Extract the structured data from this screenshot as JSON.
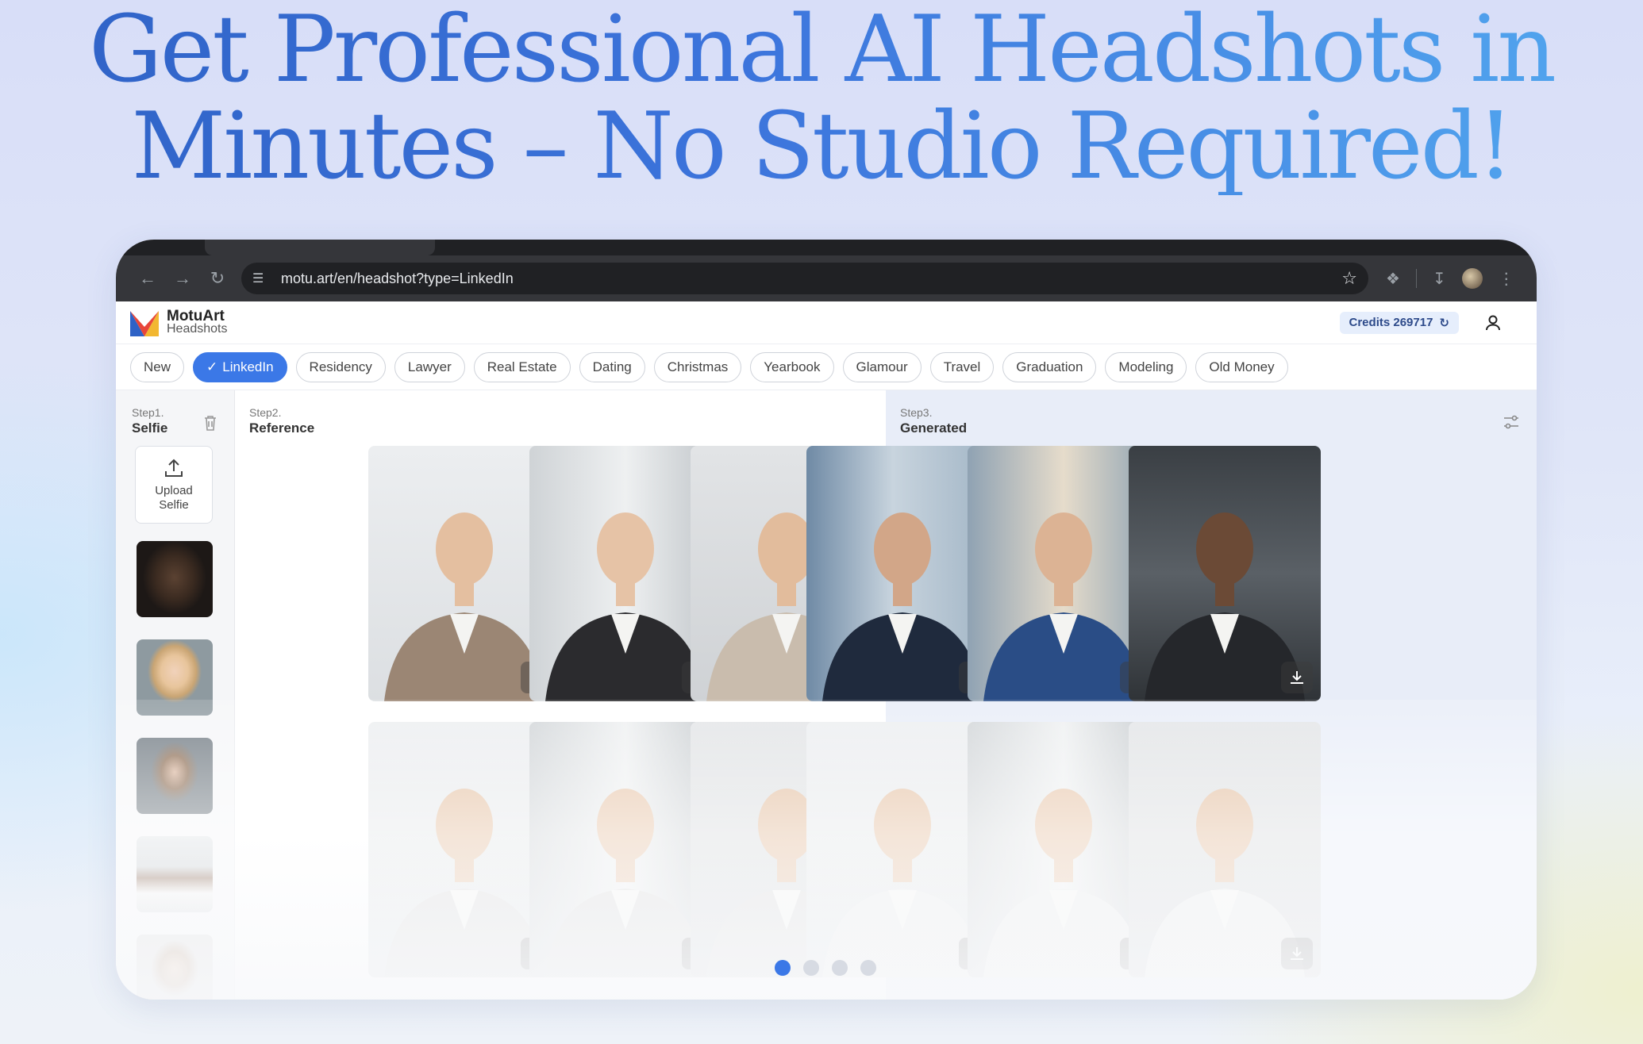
{
  "headline": {
    "line1": "Get Professional AI Headshots in",
    "line2": "Minutes – No Studio Required!"
  },
  "browser": {
    "url": "motu.art/en/headshot?type=LinkedIn",
    "icons": [
      "back-icon",
      "forward-icon",
      "reload-icon",
      "site-info-icon",
      "bookmark-star-icon",
      "extensions-icon",
      "download-icon",
      "profile-avatar",
      "menu-icon"
    ]
  },
  "app": {
    "brand": "MotuArt",
    "brand_sub": "Headshots",
    "credits_label": "Credits 269717",
    "accent": "#3b78e7"
  },
  "categories": [
    {
      "label": "New",
      "active": false
    },
    {
      "label": "LinkedIn",
      "active": true
    },
    {
      "label": "Residency",
      "active": false
    },
    {
      "label": "Lawyer",
      "active": false
    },
    {
      "label": "Real Estate",
      "active": false
    },
    {
      "label": "Dating",
      "active": false
    },
    {
      "label": "Christmas",
      "active": false
    },
    {
      "label": "Yearbook",
      "active": false
    },
    {
      "label": "Glamour",
      "active": false
    },
    {
      "label": "Travel",
      "active": false
    },
    {
      "label": "Graduation",
      "active": false
    },
    {
      "label": "Modeling",
      "active": false
    },
    {
      "label": "Old Money",
      "active": false
    }
  ],
  "steps": {
    "selfie": {
      "step": "Step1.",
      "title": "Selfie",
      "upload_label_1": "Upload",
      "upload_label_2": "Selfie"
    },
    "reference": {
      "step": "Step2.",
      "title": "Reference"
    },
    "generated": {
      "step": "Step3.",
      "title": "Generated"
    }
  },
  "carousel": {
    "pages": 4,
    "current": 1
  }
}
